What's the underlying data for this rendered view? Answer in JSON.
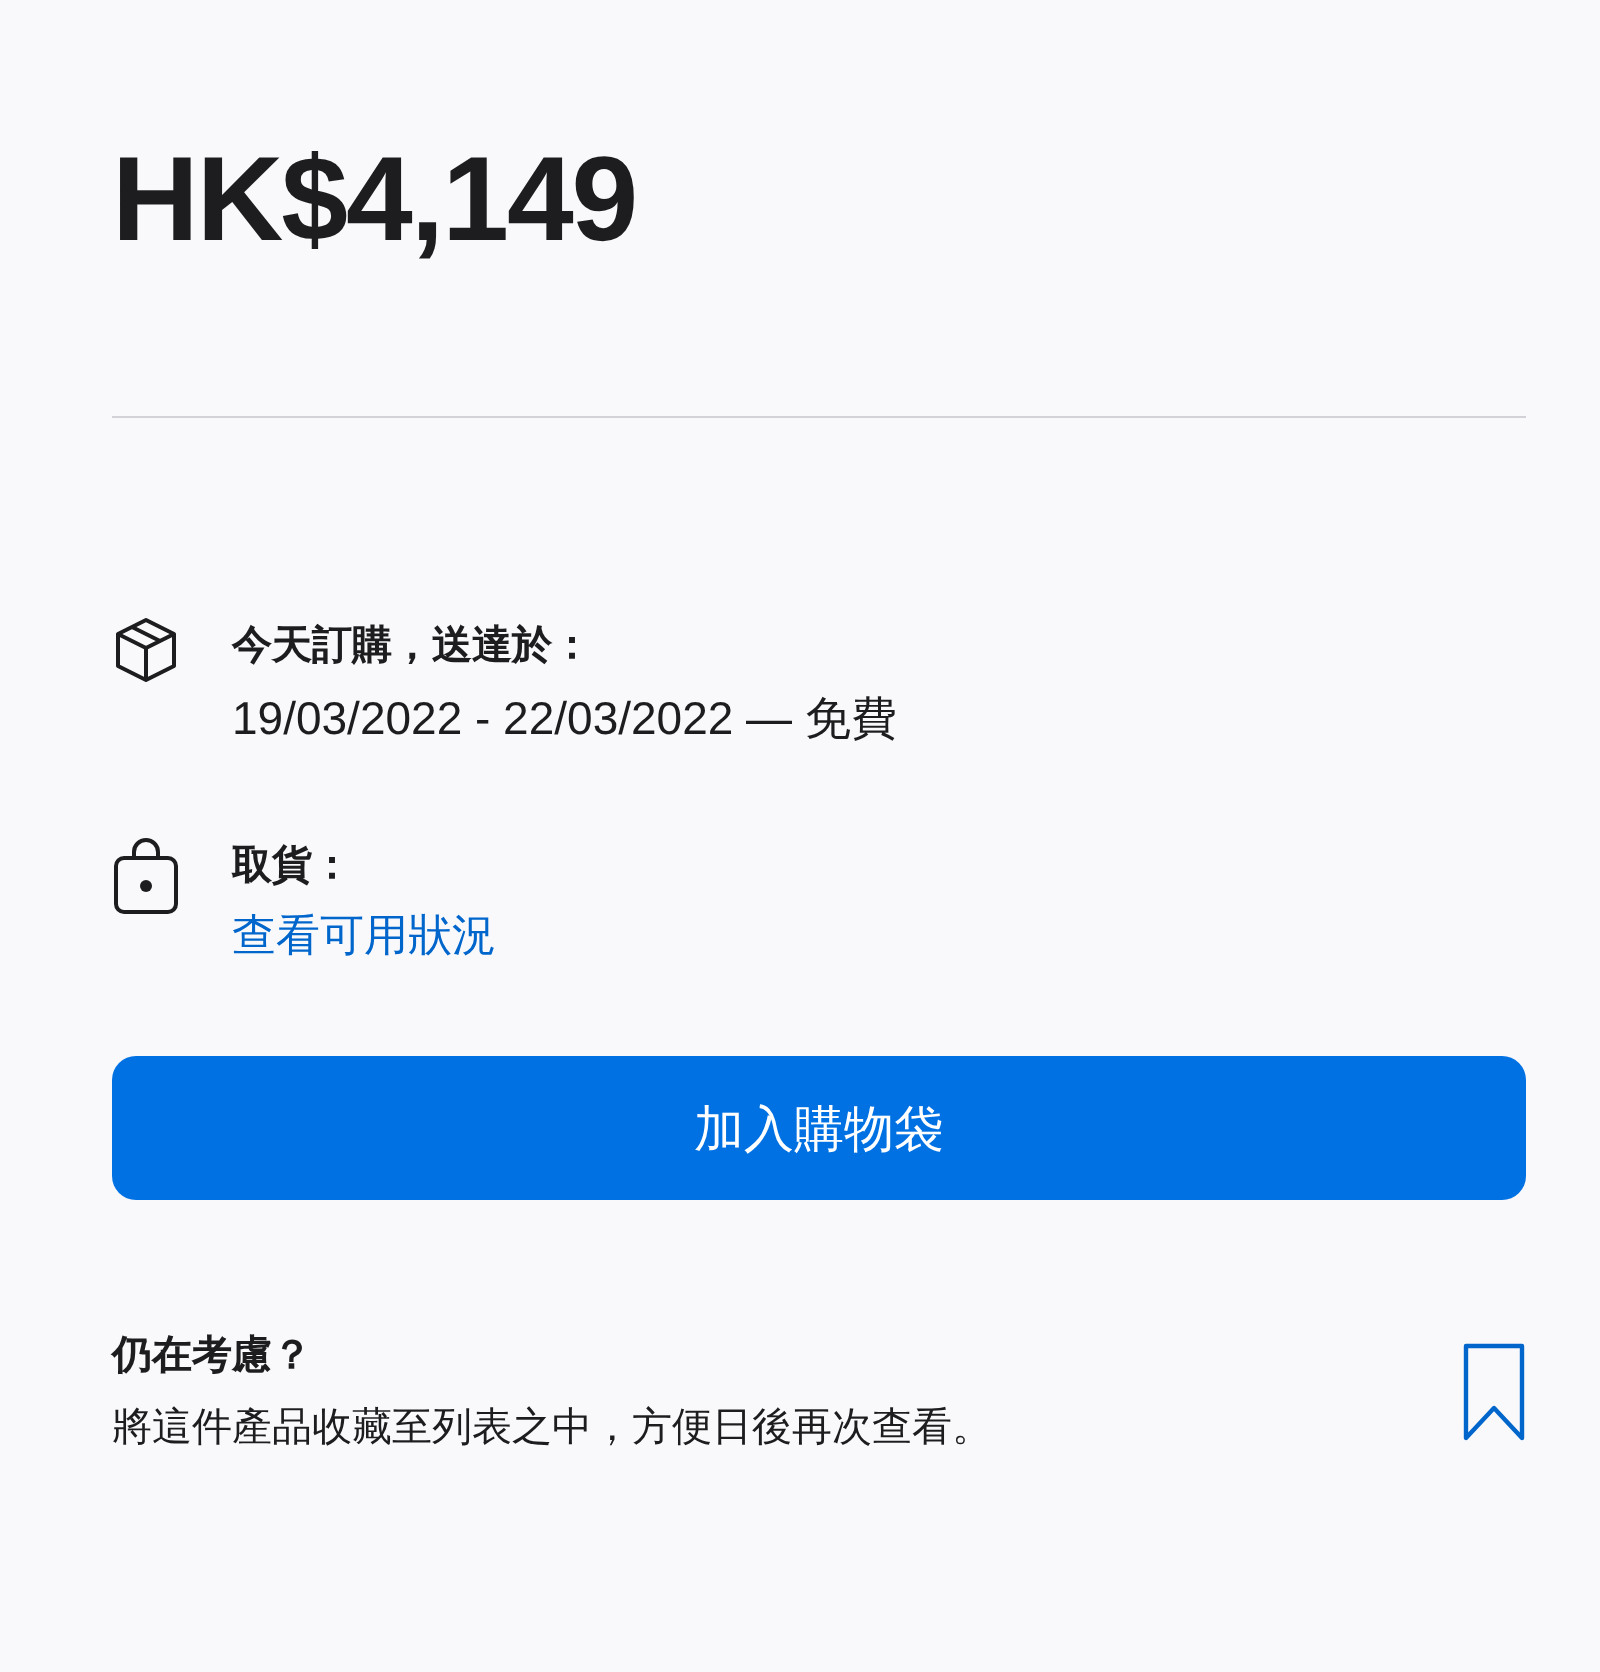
{
  "price": "HK$4,149",
  "delivery": {
    "title": "今天訂購，送達於：",
    "detail": "19/03/2022 - 22/03/2022 — 免費"
  },
  "pickup": {
    "title": "取貨：",
    "link": "查看可用狀況"
  },
  "add_button": "加入購物袋",
  "save": {
    "title": "仍在考慮？",
    "text": "將這件產品收藏至列表之中，方便日後再次查看。"
  }
}
